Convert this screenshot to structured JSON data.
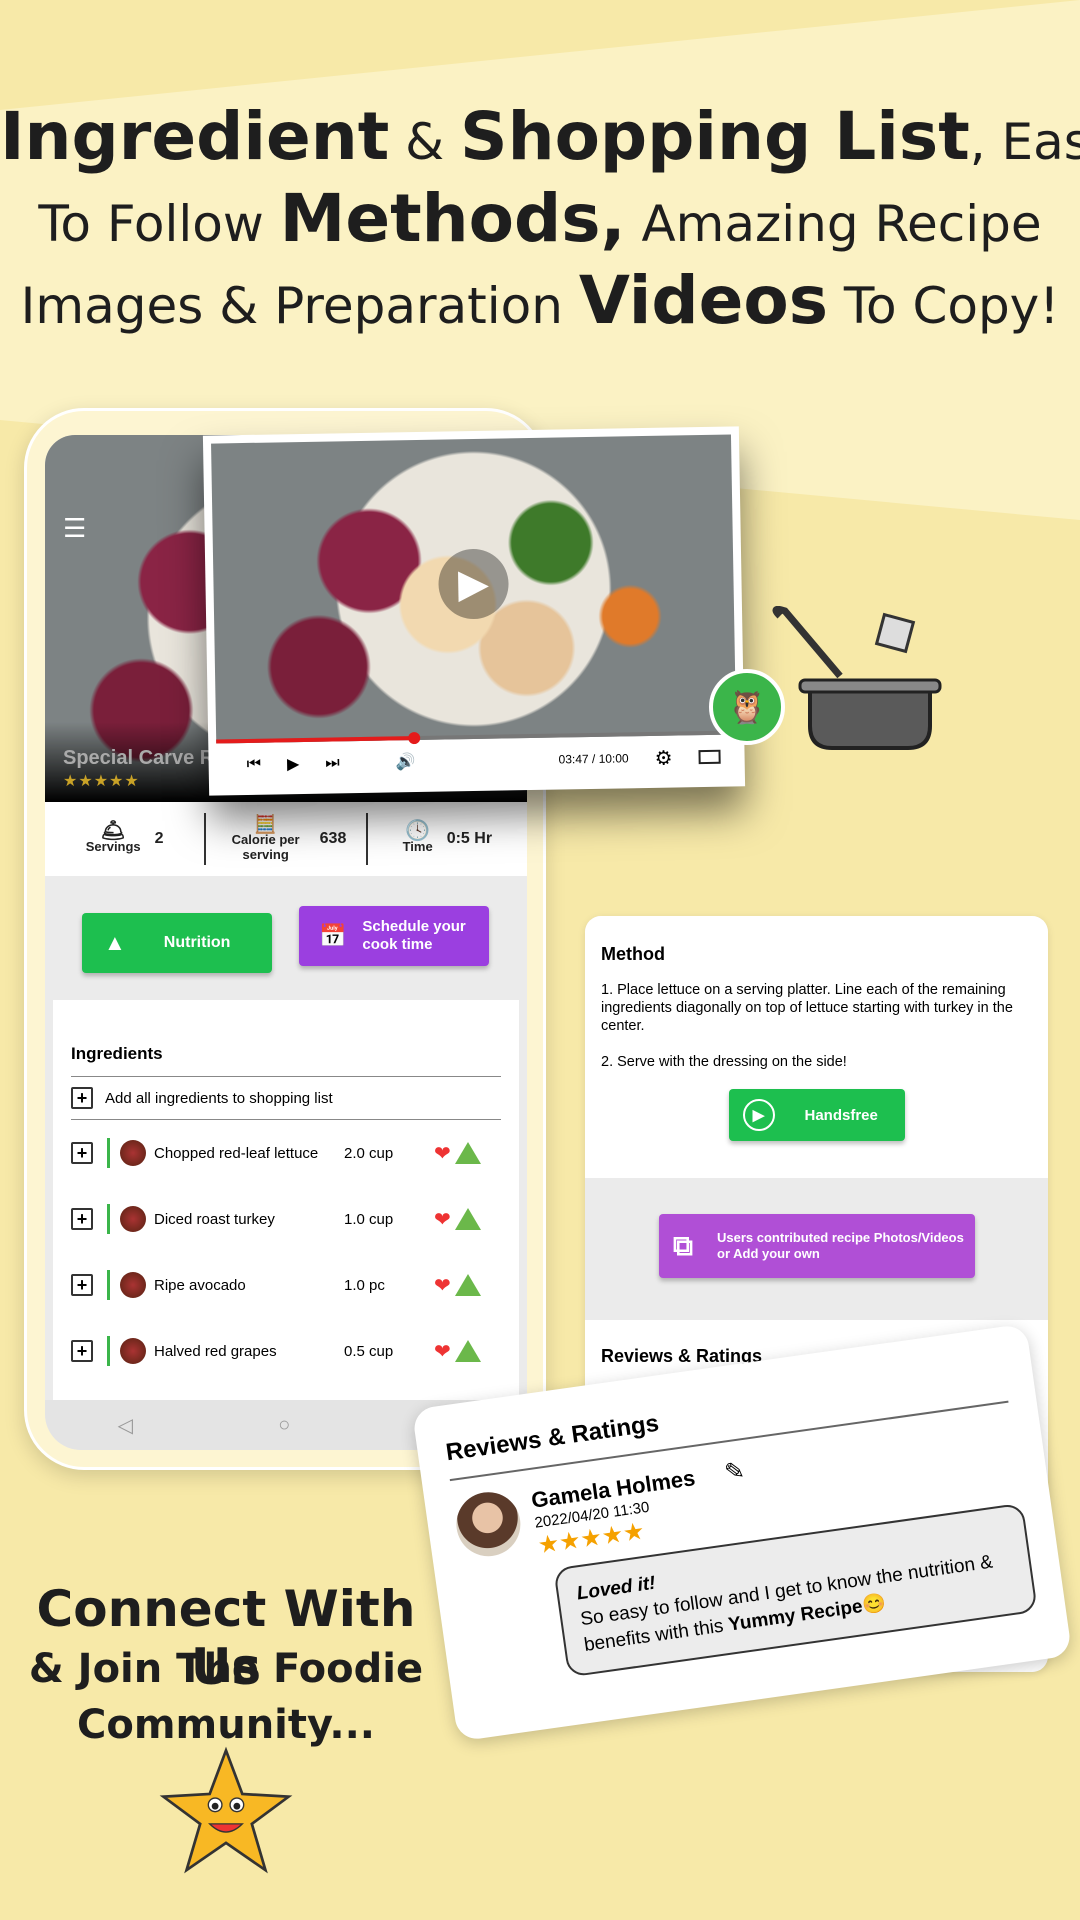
{
  "headline": {
    "l1a": "Ingredient",
    "l1b": " & ",
    "l1c": "Shopping List",
    "l1d": ", Easy",
    "l2a": "To Follow ",
    "l2b": "Methods,",
    "l2c": " Amazing Recipe",
    "l3a": "Images & Preparation ",
    "l3b": "Videos",
    "l3c": " To Copy!"
  },
  "recipe": {
    "title": "Special Carve Ro",
    "rating": 4,
    "stars": "★★★★★"
  },
  "stats": {
    "servings_label": "Servings",
    "servings": "2",
    "calorie_label": "Calorie per serving",
    "calories": "638",
    "time_label": "Time",
    "time": "0:5 Hr"
  },
  "buttons": {
    "nutrition": "Nutrition",
    "schedule": "Schedule your cook time",
    "handsfree": "Handsfree",
    "contrib": "Users contributed recipe Photos/Videos or Add your own"
  },
  "ingredients": {
    "title": "Ingredients",
    "add_all": "Add all ingredients to shopping list",
    "items": [
      {
        "name": "Chopped red-leaf lettuce",
        "qty": "2.0 cup"
      },
      {
        "name": "Diced roast turkey",
        "qty": "1.0 cup"
      },
      {
        "name": "Ripe avocado",
        "qty": "1.0 pc"
      },
      {
        "name": "Halved red grapes",
        "qty": "0.5 cup"
      }
    ]
  },
  "video": {
    "time": "03:47 / 10:00",
    "progress": 0.38
  },
  "method": {
    "title": "Method",
    "step1": "1. Place lettuce on a serving platter. Line each of the remaining ingredients diagonally on top of lettuce starting with turkey in the center.",
    "step2": "2. Serve with the dressing on the side!",
    "reviews_title": "Reviews & Ratings"
  },
  "review": {
    "title": "Reviews & Ratings",
    "name": "Gamela Holmes",
    "date": "2022/04/20 11:30",
    "stars": "★★★★★",
    "headline": "Loved it!",
    "text": "So easy to follow and I get to know the nutrition & benefits with this ",
    "bold": "Yummy Recipe",
    "emoji": "😊"
  },
  "connect": {
    "l1": "Connect With Us",
    "l2": "& Join The Foodie",
    "l3": "Community..."
  },
  "colors": {
    "green": "#1dbf4f",
    "purple": "#9b3fe0",
    "accent_red": "#e41b1b",
    "background": "#f7e9a8"
  }
}
